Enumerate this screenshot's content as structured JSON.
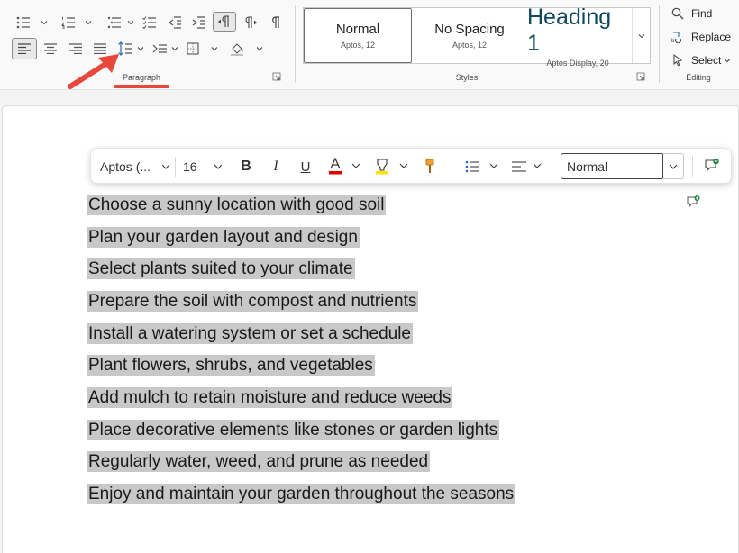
{
  "ribbon": {
    "paragraph_label": "Paragraph",
    "styles_label": "Styles",
    "editing_label": "Editing",
    "styles": [
      {
        "name": "Normal",
        "font": "Aptos, 12"
      },
      {
        "name": "No Spacing",
        "font": "Aptos, 12"
      },
      {
        "name": "Heading 1",
        "font": "Aptos Display, 20"
      }
    ],
    "editing": {
      "find_label": "Find",
      "replace_label": "Replace",
      "select_label": "Select"
    },
    "colors": {
      "heading": "#0f4761",
      "annotation_arrow": "#e8473c",
      "font_color_bar": "#e00000",
      "highlight_bar": "#ffe000"
    }
  },
  "mini_toolbar": {
    "font_name": "Aptos (...",
    "font_size": "16",
    "style_value": "Normal"
  },
  "document": {
    "paragraphs": [
      "Choose a sunny location with good soil",
      "Plan your garden layout and design",
      "Select plants suited to your climate",
      "Prepare the soil with compost and nutrients",
      "Install a watering system or set a schedule",
      "Plant flowers, shrubs, and vegetables",
      "Add mulch to retain moisture and reduce weeds",
      "Place decorative elements like stones or garden lights",
      "Regularly water, weed, and prune as needed",
      "Enjoy and maintain your garden throughout the seasons"
    ]
  }
}
